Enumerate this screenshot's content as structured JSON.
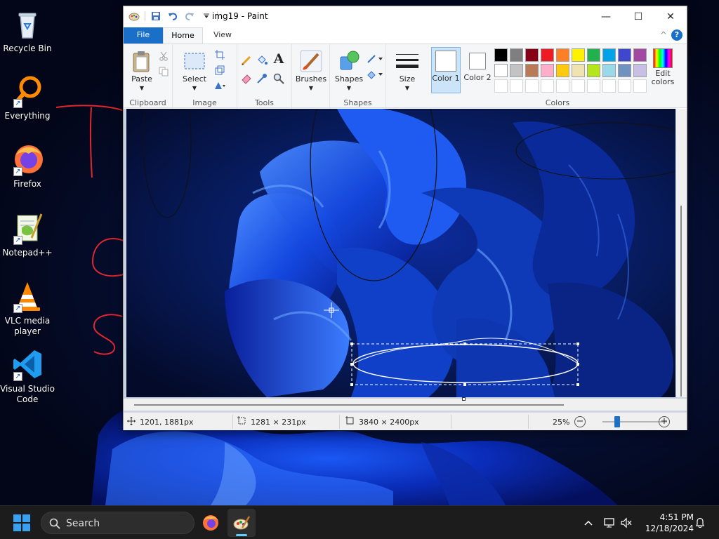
{
  "desktop": {
    "icons": [
      {
        "label": "Recycle Bin",
        "icon": "recycle-bin-icon"
      },
      {
        "label": "Everything",
        "icon": "everything-search-icon"
      },
      {
        "label": "Firefox",
        "icon": "firefox-icon"
      },
      {
        "label": "Notepad++",
        "icon": "notepad-plus-plus-icon"
      },
      {
        "label": "VLC media player",
        "icon": "vlc-icon"
      },
      {
        "label": "Visual Studio Code",
        "icon": "vscode-icon"
      }
    ]
  },
  "window": {
    "title": "img19 - Paint",
    "controls": {
      "minimize": "—",
      "maximize": "☐",
      "close": "✕"
    }
  },
  "ribbon": {
    "tabs": [
      {
        "label": "File",
        "active": false
      },
      {
        "label": "Home",
        "active": true
      },
      {
        "label": "View",
        "active": false
      }
    ],
    "help": "?",
    "collapse": "^",
    "groups": {
      "clipboard": {
        "label": "Clipboard",
        "paste": "Paste"
      },
      "image": {
        "label": "Image",
        "select": "Select"
      },
      "tools": {
        "label": "Tools",
        "text_tool": "A"
      },
      "brushes": {
        "label": "Brushes"
      },
      "shapes": {
        "label": "Shapes",
        "shapes_button": "Shapes"
      },
      "size": {
        "label": "Size"
      },
      "colors": {
        "label": "Colors",
        "color1": "Color 1",
        "color2": "Color 2",
        "edit_colors": "Edit colors",
        "palette_row1": [
          "#000000",
          "#7f7f7f",
          "#880015",
          "#ed1c24",
          "#ff7f27",
          "#fff200",
          "#22b14c",
          "#00a2e8",
          "#3f48cc",
          "#a349a4"
        ],
        "palette_row2": [
          "#ffffff",
          "#c3c3c3",
          "#b97a57",
          "#ffaec9",
          "#ffc90e",
          "#efe4b0",
          "#b5e61d",
          "#99d9ea",
          "#7092be",
          "#c8bfe7"
        ]
      }
    }
  },
  "status": {
    "cursor_pos": "1201, 1881px",
    "selection_size": "1281 × 231px",
    "image_size": "3840 × 2400px",
    "zoom": "25%",
    "zoom_fraction": 0.2
  },
  "taskbar": {
    "search_label": "Search",
    "time": "4:51 PM",
    "date": "12/18/2024"
  },
  "colors": {
    "accent": "#1a6fc9",
    "annotation_red": "#e0262e"
  }
}
